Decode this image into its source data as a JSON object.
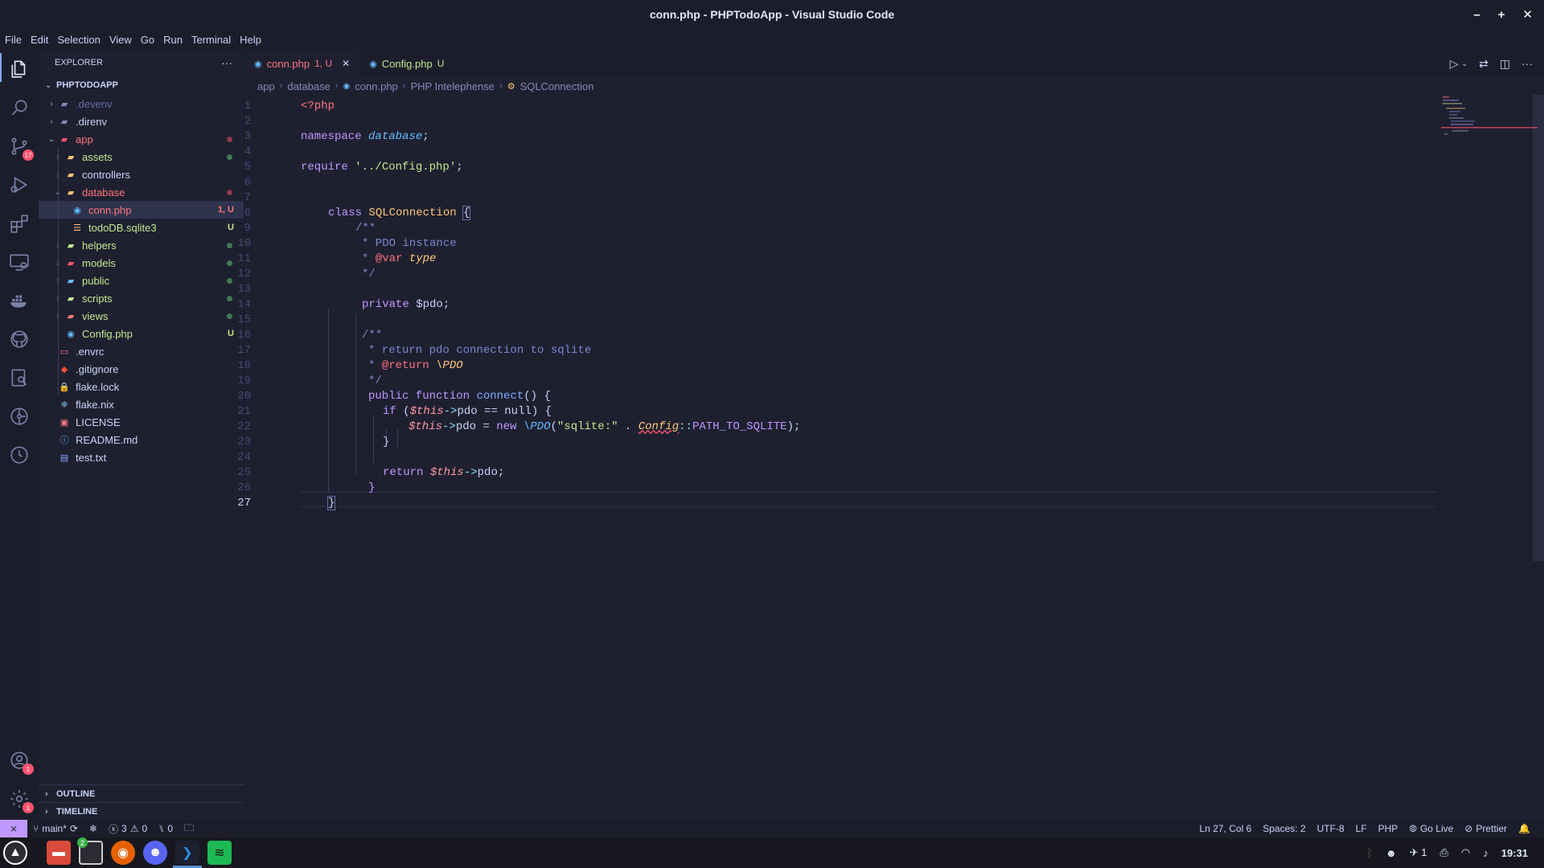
{
  "window": {
    "title": "conn.php - PHPTodoApp - Visual Studio Code",
    "controls": [
      "–",
      "+",
      "✕"
    ]
  },
  "menu": [
    "File",
    "Edit",
    "Selection",
    "View",
    "Go",
    "Run",
    "Terminal",
    "Help"
  ],
  "activity": {
    "source_control_badge": "17",
    "accounts_badge": "1",
    "settings_badge": "1"
  },
  "explorer": {
    "header": "EXPLORER",
    "more": "···",
    "project": "PHPTODOAPP",
    "items": [
      {
        "label": ".devenv",
        "depth": 0,
        "type": "folder",
        "color": "#636da6",
        "chev": "›"
      },
      {
        "label": ".direnv",
        "depth": 0,
        "type": "folder",
        "color": "#c8d3f5",
        "chev": "›"
      },
      {
        "label": "app",
        "depth": 0,
        "type": "folder-open",
        "color": "#ff757f",
        "chev": "⌄",
        "status": "dot-red"
      },
      {
        "label": "assets",
        "depth": 1,
        "type": "folder",
        "color": "#c3e88d",
        "chev": "›",
        "status": "dot-green"
      },
      {
        "label": "controllers",
        "depth": 1,
        "type": "folder",
        "color": "#c8d3f5",
        "chev": "›"
      },
      {
        "label": "database",
        "depth": 1,
        "type": "folder-open",
        "color": "#ff757f",
        "chev": "⌄",
        "status": "dot-red"
      },
      {
        "label": "conn.php",
        "depth": 2,
        "type": "php",
        "color": "#ff757f",
        "badge": "1, U",
        "selected": true
      },
      {
        "label": "todoDB.sqlite3",
        "depth": 2,
        "type": "db",
        "color": "#c3e88d",
        "badge": "U"
      },
      {
        "label": "helpers",
        "depth": 1,
        "type": "folder",
        "color": "#c3e88d",
        "chev": "›",
        "status": "dot-green"
      },
      {
        "label": "models",
        "depth": 1,
        "type": "folder",
        "color": "#c3e88d",
        "chev": "›",
        "status": "dot-green"
      },
      {
        "label": "public",
        "depth": 1,
        "type": "folder",
        "color": "#c3e88d",
        "chev": "›",
        "status": "dot-green"
      },
      {
        "label": "scripts",
        "depth": 1,
        "type": "folder",
        "color": "#c3e88d",
        "chev": "›",
        "status": "dot-green"
      },
      {
        "label": "views",
        "depth": 1,
        "type": "folder",
        "color": "#c3e88d",
        "chev": "›",
        "status": "dot-green"
      },
      {
        "label": "Config.php",
        "depth": 1,
        "type": "php",
        "color": "#c3e88d",
        "badge": "U"
      },
      {
        "label": ".envrc",
        "depth": 0,
        "type": "file",
        "color": "#c8d3f5"
      },
      {
        "label": ".gitignore",
        "depth": 0,
        "type": "git",
        "color": "#c8d3f5"
      },
      {
        "label": "flake.lock",
        "depth": 0,
        "type": "lock",
        "color": "#c8d3f5"
      },
      {
        "label": "flake.nix",
        "depth": 0,
        "type": "nix",
        "color": "#c8d3f5"
      },
      {
        "label": "LICENSE",
        "depth": 0,
        "type": "license",
        "color": "#c8d3f5"
      },
      {
        "label": "README.md",
        "depth": 0,
        "type": "info",
        "color": "#c8d3f5"
      },
      {
        "label": "test.txt",
        "depth": 0,
        "type": "txt",
        "color": "#c8d3f5"
      }
    ],
    "outline": "OUTLINE",
    "timeline": "TIMELINE"
  },
  "tabs": [
    {
      "label": "conn.php",
      "status": "1, U",
      "close": "✕",
      "active": true
    },
    {
      "label": "Config.php",
      "status": "U",
      "active": false
    }
  ],
  "breadcrumbs": [
    "app",
    "database",
    "conn.php",
    "PHP Intelephense",
    "SQLConnection"
  ],
  "editor": {
    "current_line": 27,
    "line_numbers": [
      "1",
      "2",
      "3",
      "4",
      "5",
      "6",
      "7",
      "8",
      "9",
      "10",
      "11",
      "12",
      "13",
      "14",
      "15",
      "16",
      "17",
      "18",
      "19",
      "20",
      "21",
      "22",
      "23",
      "24",
      "25",
      "26",
      "27"
    ],
    "code": {
      "l1": "<?php",
      "l3_kw": "namespace",
      "l3_ns": "database",
      "l3_end": ";",
      "l5_kw": "require",
      "l5_str": "'../Config.php'",
      "l5_end": ";",
      "l8_kw": "class",
      "l8_cls": "SQLConnection",
      "l8_brace": "{",
      "l9": "/**",
      "l10": "* PDO instance",
      "l11_a": "* ",
      "l11_tag": "@var",
      "l11_type": "type",
      "l12": "*/",
      "l14_kw": "private",
      "l14_var": "$pdo;",
      "l16": "/**",
      "l17": "* return pdo connection to sqlite",
      "l18_a": "* ",
      "l18_tag": "@return",
      "l18_type": "\\PDO",
      "l19": "*/",
      "l20_kw": "public function",
      "l20_fn": "connect",
      "l20_rest": "() {",
      "l21_kw": "if",
      "l21_p": " (",
      "l21_this": "$this",
      "l21_op": "->",
      "l21_rest": "pdo == null) {",
      "l22_this": "$this",
      "l22_op": "->",
      "l22_a": "pdo = ",
      "l22_new": "new",
      "l22_cls": " \\PDO",
      "l22_p": "(",
      "l22_str": "\"sqlite:\"",
      "l22_dot": " . ",
      "l22_cfg": "Config",
      "l22_c": "::",
      "l22_const": "PATH_TO_SQLITE",
      "l22_end": ");",
      "l23": "}",
      "l25_kw": "return",
      "l25_this": " $this",
      "l25_op": "->",
      "l25_rest": "pdo;",
      "l26": "}",
      "l27": "}"
    }
  },
  "status": {
    "branch": "main*",
    "errors": "3",
    "warnings": "0",
    "ports": "0",
    "position": "Ln 27, Col 6",
    "spaces": "Spaces: 2",
    "encoding": "UTF-8",
    "eol": "LF",
    "language": "PHP",
    "golive": "Go Live",
    "prettier": "Prettier"
  },
  "taskbar": {
    "terminal_badge": "2",
    "tray_count": "1",
    "clock": "19:31"
  }
}
